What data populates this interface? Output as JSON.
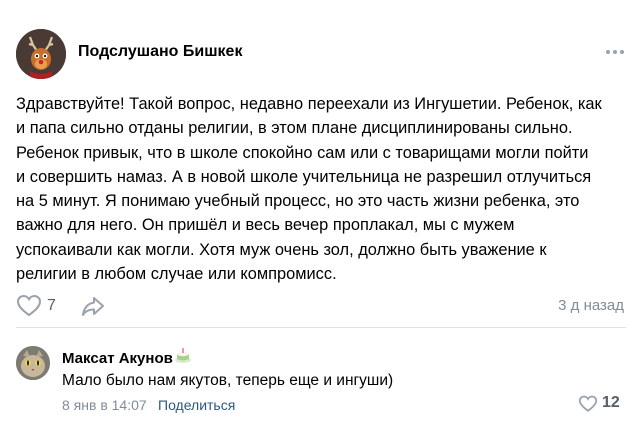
{
  "post": {
    "group_name": "Подслушано Бишкек",
    "text_lines": [
      "Здравствуйте! Такой вопрос, недавно переехали из Ингушетии. Ребенок, как",
      "и папа сильно отданы религии, в этом плане дисциплинированы сильно.",
      "Ребенок привык, что в школе спокойно сам или с товарищами могли пойти",
      "и совершить намаз. А в новой школе учительница не разрешил отлучиться",
      "на 5 минут. Я понимаю учебный процесс, но это часть жизни ребенка, это",
      "важно для него. Он пришёл и весь вечер проплакал, мы с мужем",
      "успокаивали как могли. Хотя муж очень зол, должно быть уважение к",
      "религии в любом случае или компромисс."
    ],
    "likes": "7",
    "time": "3 д назад"
  },
  "comment": {
    "author": "Максат Акунов",
    "text": "Мало было нам якутов, теперь еще и ингуши)",
    "date": "8 янв в 14:07",
    "share_label": "Поделиться",
    "likes": "12"
  },
  "icons": {
    "group_avatar": "reindeer-logo-icon",
    "more": "more-dots-icon",
    "like": "heart-outline-icon",
    "share": "share-arrow-icon",
    "author_badge": "cake-badge-icon",
    "user_avatar": "cat-avatar-icon"
  },
  "colors": {
    "secondary_text": "#818c99",
    "link": "#2a5885",
    "icon": "#99a2ad"
  }
}
